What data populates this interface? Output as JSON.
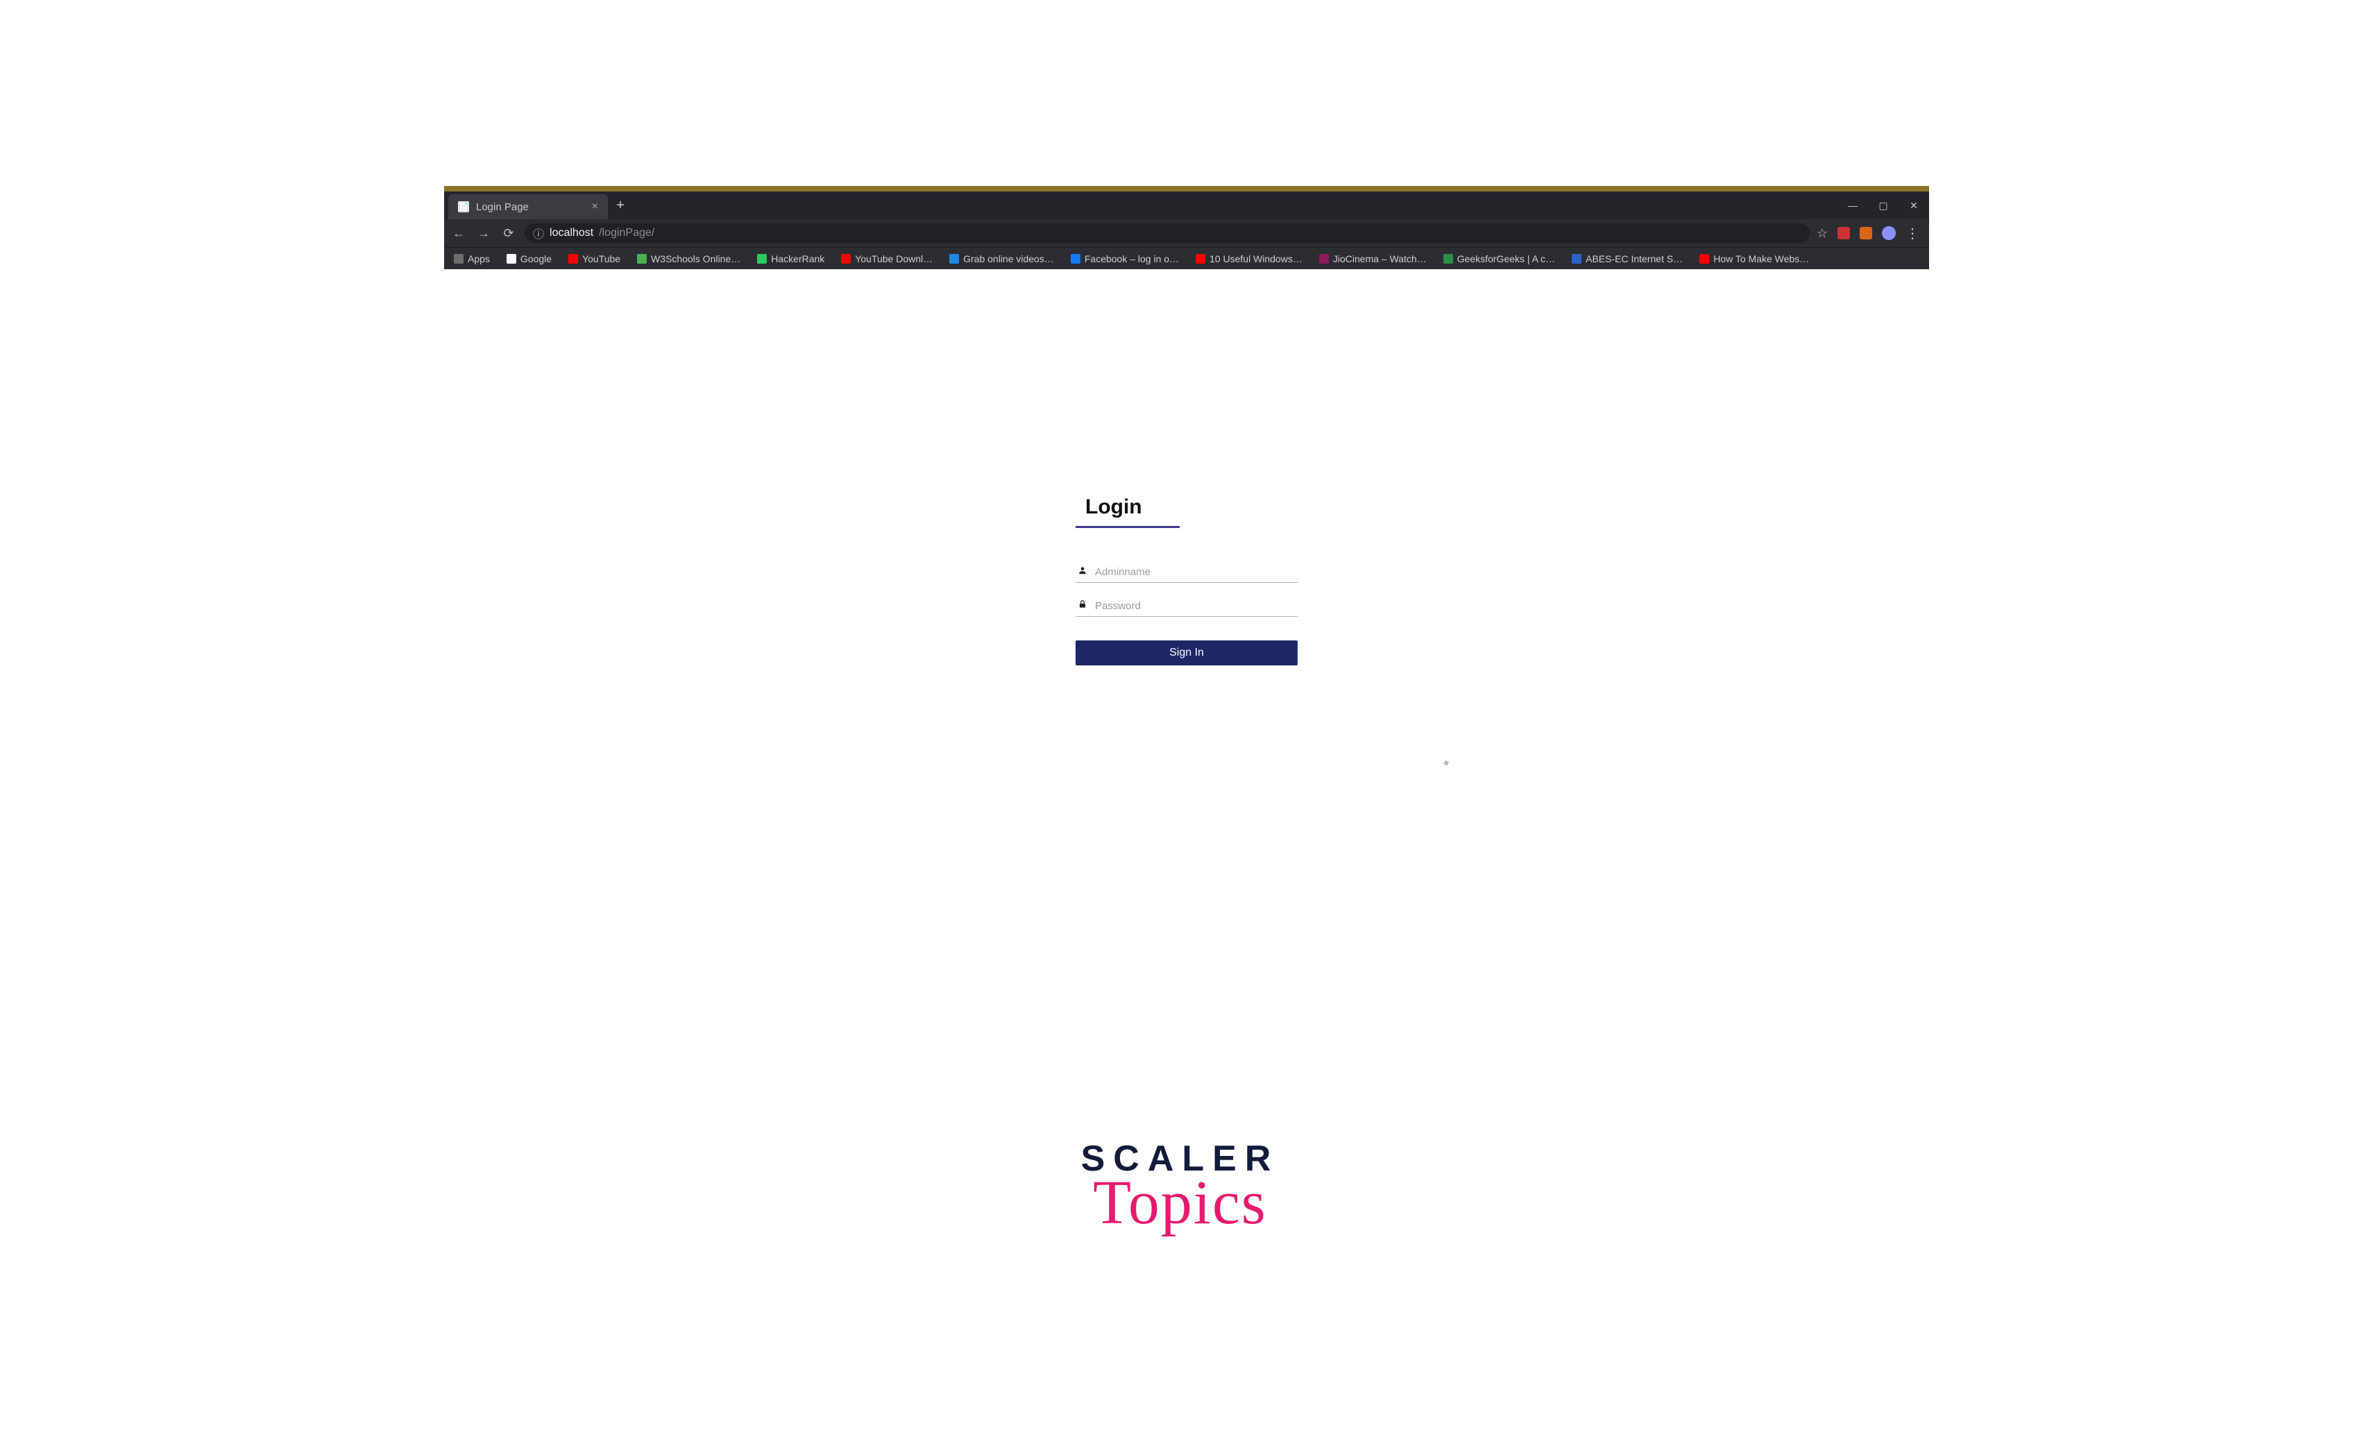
{
  "browser": {
    "tab": {
      "title": "Login Page"
    },
    "new_tab_glyph": "+",
    "window": {
      "minimize": "—",
      "maximize": "▢",
      "close": "✕"
    },
    "nav": {
      "back": "←",
      "forward": "→",
      "reload": "⟳",
      "secure_icon": "ⓘ"
    },
    "url": {
      "host": "localhost",
      "path": "/loginPage/"
    },
    "actions": {
      "star": "☆",
      "menu": "⋮"
    },
    "bookmarks": [
      {
        "label": "Apps",
        "icon": "#6e6e6e"
      },
      {
        "label": "Google",
        "icon": "#ffffff"
      },
      {
        "label": "YouTube",
        "icon": "#ff0000"
      },
      {
        "label": "W3Schools Online…",
        "icon": "#4caf50"
      },
      {
        "label": "HackerRank",
        "icon": "#2ec866"
      },
      {
        "label": "YouTube Downl…",
        "icon": "#ff0000"
      },
      {
        "label": "Grab online videos…",
        "icon": "#1e88e5"
      },
      {
        "label": "Facebook – log in o…",
        "icon": "#1877f2"
      },
      {
        "label": "10 Useful Windows…",
        "icon": "#ff0000"
      },
      {
        "label": "JioCinema – Watch…",
        "icon": "#8e1b5a"
      },
      {
        "label": "GeeksforGeeks | A c…",
        "icon": "#2f8d46"
      },
      {
        "label": "ABES-EC Internet S…",
        "icon": "#2963c8"
      },
      {
        "label": "How To Make Webs…",
        "icon": "#ff0000"
      }
    ]
  },
  "login": {
    "title": "Login",
    "username_placeholder": "Adminname",
    "password_placeholder": "Password",
    "submit_label": "Sign In"
  },
  "watermark": {
    "line1": "SCALER",
    "line2": "Topics"
  },
  "colors": {
    "accent": "#1e2766",
    "underline": "#3c3a8d",
    "brand_pink": "#e51b6e",
    "brand_navy": "#141b3a"
  }
}
